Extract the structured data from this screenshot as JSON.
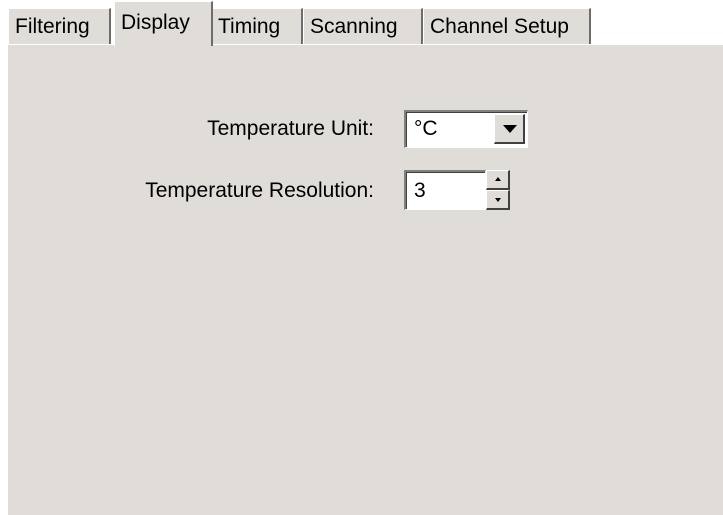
{
  "tabs": {
    "items": [
      {
        "label": "Filtering"
      },
      {
        "label": "Display",
        "active": true
      },
      {
        "label": "Timing"
      },
      {
        "label": "Scanning"
      },
      {
        "label": "Channel Setup"
      }
    ]
  },
  "display": {
    "temperature_unit_label": "Temperature Unit:",
    "temperature_unit_value": "°C",
    "temperature_resolution_label": "Temperature Resolution:",
    "temperature_resolution_value": "3"
  },
  "icons": {
    "combo_arrow": "chevron-down-icon",
    "spin_up": "spin-up-icon",
    "spin_down": "spin-down-icon"
  },
  "colors": {
    "panel_background": "#e0dcd8",
    "field_background": "#ffffff"
  }
}
